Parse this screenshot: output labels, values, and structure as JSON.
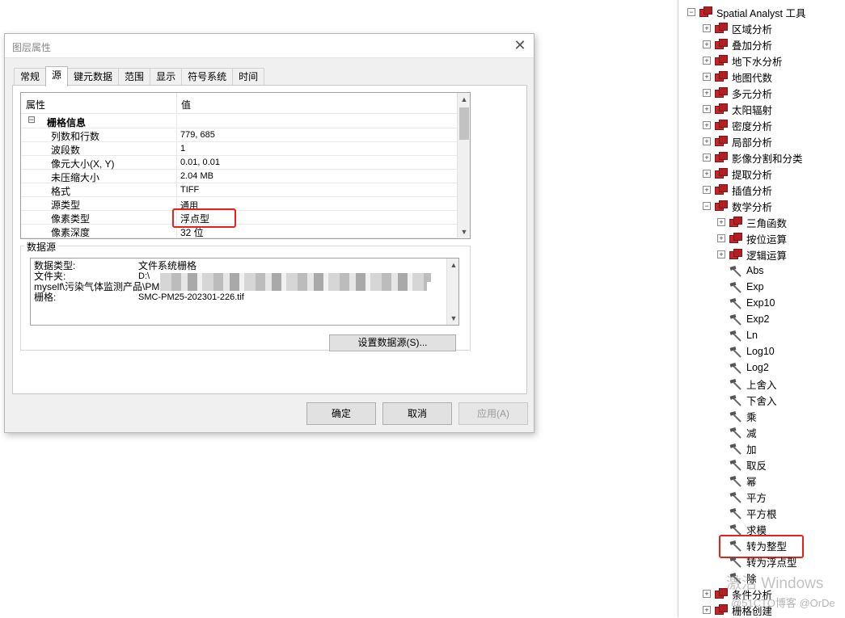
{
  "dialog": {
    "title": "图层属性",
    "close_glyph": "✕",
    "tabs": [
      "常规",
      "源",
      "键元数据",
      "范围",
      "显示",
      "符号系统",
      "时间"
    ],
    "active_tab": "源",
    "grid": {
      "col_property": "属性",
      "col_value": "值",
      "group_glyph": "⊟",
      "group": "栅格信息",
      "rows": [
        {
          "k": "列数和行数",
          "v": "779, 685"
        },
        {
          "k": "波段数",
          "v": "1"
        },
        {
          "k": "像元大小(X, Y)",
          "v": "0.01, 0.01"
        },
        {
          "k": "未压缩大小",
          "v": "2.04 MB"
        },
        {
          "k": "格式",
          "v": "TIFF"
        },
        {
          "k": "源类型",
          "v": "通用"
        },
        {
          "k": "像素类型",
          "v": "浮点型"
        },
        {
          "k": "像素深度",
          "v": "32 位"
        }
      ]
    },
    "datasource": {
      "legend": "数据源",
      "lines": [
        {
          "k": "数据类型:",
          "v": "文件系统栅格"
        },
        {
          "k": "文件夹:",
          "v": "D:\\"
        },
        {
          "k": "myself\\污染气体监测产品\\PM2.5\\",
          "v": ""
        },
        {
          "k": "栅格:",
          "v": "SMC-PM25-202301-226.tif"
        }
      ],
      "set_source_button": "设置数据源(S)..."
    },
    "buttons": {
      "ok": "确定",
      "cancel": "取消",
      "apply": "应用(A)"
    }
  },
  "tree": {
    "root": "Spatial Analyst 工具",
    "toolsets": [
      "区域分析",
      "叠加分析",
      "地下水分析",
      "地图代数",
      "多元分析",
      "太阳辐射",
      "密度分析",
      "局部分析",
      "影像分割和分类",
      "提取分析",
      "插值分析",
      "数学分析"
    ],
    "math_subsets": [
      "三角函数",
      "按位运算",
      "逻辑运算"
    ],
    "math_tools": [
      "Abs",
      "Exp",
      "Exp10",
      "Exp2",
      "Ln",
      "Log10",
      "Log2",
      "上舍入",
      "下舍入",
      "乘",
      "减",
      "加",
      "取反",
      "幂",
      "平方",
      "平方根",
      "求模",
      "转为整型",
      "转为浮点型",
      "除"
    ],
    "after": [
      "条件分析",
      "栅格创建"
    ],
    "plus": "+",
    "minus": "−",
    "highlighted_tool": "转为整型"
  },
  "overlay": {
    "watermark": "激活 Windows",
    "credit": "@51CTO博客 @OrDe"
  },
  "colors": {
    "highlight": "#e8201c",
    "toolbox": "#c8252b"
  }
}
